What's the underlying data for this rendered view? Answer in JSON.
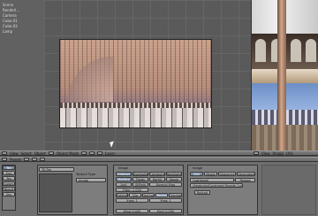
{
  "outliner": {
    "items": [
      "Scene",
      "Renderl...",
      "Camera",
      "Cube.01",
      "Cube.03",
      "Lamp"
    ]
  },
  "viewport_header": {
    "items": [
      "View",
      "Select",
      "Object",
      "Object Mode"
    ],
    "layer_label": "Layer"
  },
  "right_header": {
    "items": [
      "View",
      "Image",
      "UVs"
    ]
  },
  "panels_header": {
    "items": [
      "Panels",
      "Texture"
    ]
  },
  "props": {
    "tex_name": "TE:Tex",
    "texture_type_label": "Texture Type",
    "texture_type_value": "Image",
    "left_buttons": [
      "Tex",
      "Env",
      "Tex",
      "Colors",
      "Blend",
      "Sky"
    ],
    "image_tab": "Image",
    "image_buttons": [
      "Interpol",
      "UseAlpha",
      "CalcAlpha",
      "NegAlpha",
      "MipMap",
      "Fields",
      "Rot90",
      "Movie",
      "Anti",
      "StField",
      "Normal Map",
      "Filter: 1.000",
      "Extend",
      "Clip",
      "ClipCube",
      "Repeat",
      "Checker",
      "Xrep: 1",
      "Yrep: 1",
      "MinX 0.000",
      "MinY 0.000"
    ],
    "image_panel_title": "Image",
    "image_panel_tabs": [
      "Still",
      "Movie",
      "Sequence",
      "Generated"
    ],
    "image_name": "Castlewall",
    "image_path": "//textures/Courtyard Facade 1.png",
    "reload_button": "Reload",
    "reload2_button": "Reload"
  }
}
